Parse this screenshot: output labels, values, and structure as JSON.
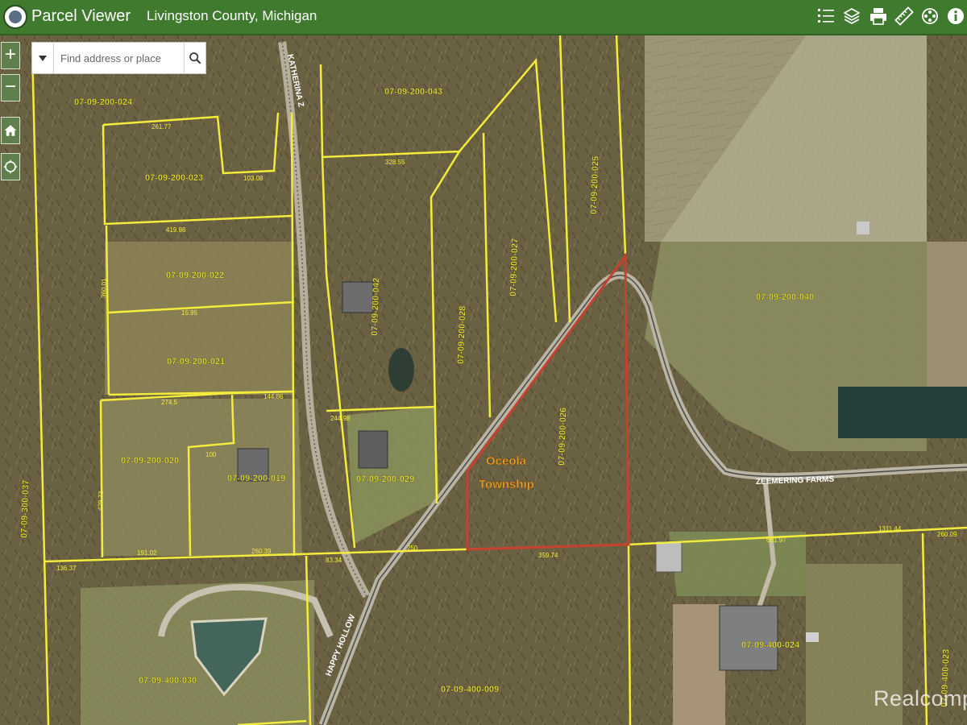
{
  "header": {
    "app_title": "Parcel Viewer",
    "county": "Livingston County, Michigan"
  },
  "toolbar": {
    "icons": [
      "legend-icon",
      "layers-icon",
      "print-icon",
      "measure-icon",
      "film-reel-icon",
      "info-icon"
    ]
  },
  "search": {
    "placeholder": "Find address or place"
  },
  "zoom": {
    "in": "+",
    "out": "−"
  },
  "map": {
    "parcels": [
      "07-09-200-024",
      "07-09-200-043",
      "07-09-200-023",
      "07-09-200-025",
      "07-09-200-027",
      "07-09-200-022",
      "07-09-200-042",
      "07-09-200-028",
      "07-09-200-040",
      "07-09-200-021",
      "07-09-200-026",
      "07-09-200-020",
      "07-09-200-019",
      "07-09-200-029",
      "07-09-300-037",
      "07-09-400-030",
      "07-09-400-009",
      "07-09-400-024",
      "07-09-400-023"
    ],
    "roads": [
      "KATHERINA Z",
      "HAPPY HOLLOW",
      "ZEEMERING FARMS"
    ],
    "township": [
      "Oceola",
      "Township"
    ],
    "dimensions": [
      "261.77",
      "328.55",
      "419.86",
      "103.08",
      "15.95",
      "274.5",
      "144.86",
      "244.98",
      "100",
      "136.37",
      "191.02",
      "260.39",
      "83.34",
      "250",
      "359.74",
      "661.97",
      "1311.44",
      "260.09",
      "360.01",
      "429.73"
    ]
  },
  "watermark": "Realcomp"
}
